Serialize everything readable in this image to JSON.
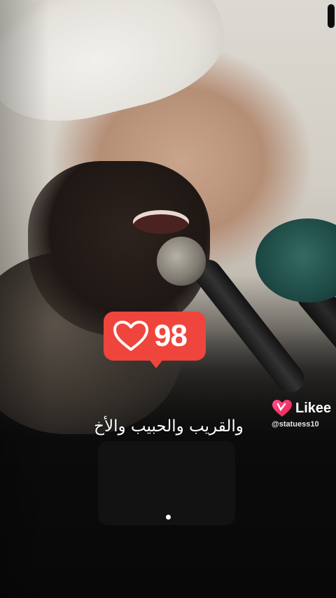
{
  "like_badge": {
    "count": "98",
    "icon": "heart-outline-icon",
    "color": "#f0453c"
  },
  "caption": "والقريب والحبيب والأخ",
  "watermark": {
    "brand": "Likee",
    "handle": "@statuess10",
    "icon": "likee-heart-icon"
  },
  "progress_indicator": {
    "icon": "dot-indicator"
  }
}
